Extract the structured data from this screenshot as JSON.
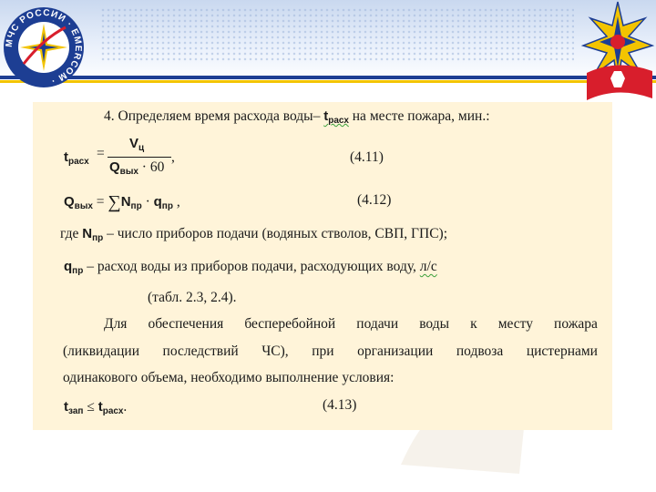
{
  "slide": {
    "line1": "4. Определяем время расхода воды–",
    "line1_symbol": "t",
    "line1_sub": "расх",
    "line1_tail": "на месте пожара, мин.:",
    "f1": {
      "lhs": "t",
      "lhs_sub": "расх",
      "eq": "=",
      "num": "V",
      "num_sub": "ц",
      "den": "Q",
      "den_sub": "вых",
      "den_mult": "· 60",
      "comma": ",",
      "number": "(4.11)"
    },
    "f2": {
      "lhs": "Q",
      "lhs_sub": "вых",
      "eq": "=",
      "sigma": "∑",
      "n": "N",
      "n_sub": "пр",
      "dot": "·",
      "q": "q",
      "q_sub": "пр",
      "comma": ",",
      "number": "(4.12)"
    },
    "def1_prefix": "где",
    "def1_sym": "N",
    "def1_sub": "пр",
    "def1_text": "– число приборов подачи (водяных стволов, СВП, ГПС);",
    "def2_sym": "q",
    "def2_sub": "пр",
    "def2_text": "– расход воды из приборов подачи, расходующих воду,",
    "def2_unit": "л/с",
    "table_ref": "(табл. 2.3, 2.4).",
    "para_line1": [
      "Для",
      "обеспечения",
      "бесперебойной",
      "подачи",
      "воды",
      "к",
      "месту",
      "пожара"
    ],
    "para_line2": [
      "(ликвидации",
      "последствий",
      "ЧС),",
      "при",
      "организации",
      "подвоза",
      "цистернами"
    ],
    "para_line3": "одинакового объема, необходимо выполнение условия:",
    "f3": {
      "lhs": "t",
      "lhs_sub": "зап",
      "op": "≤",
      "rhs": "t",
      "rhs_sub": "расх",
      "dot": ".",
      "number": "(4.13)"
    }
  },
  "logos": {
    "left_text": "МЧС РОССИИ · EMERCOM ·",
    "left_color": "#1d3e93",
    "accent_yellow": "#f3c400",
    "accent_red": "#d81e2c"
  }
}
